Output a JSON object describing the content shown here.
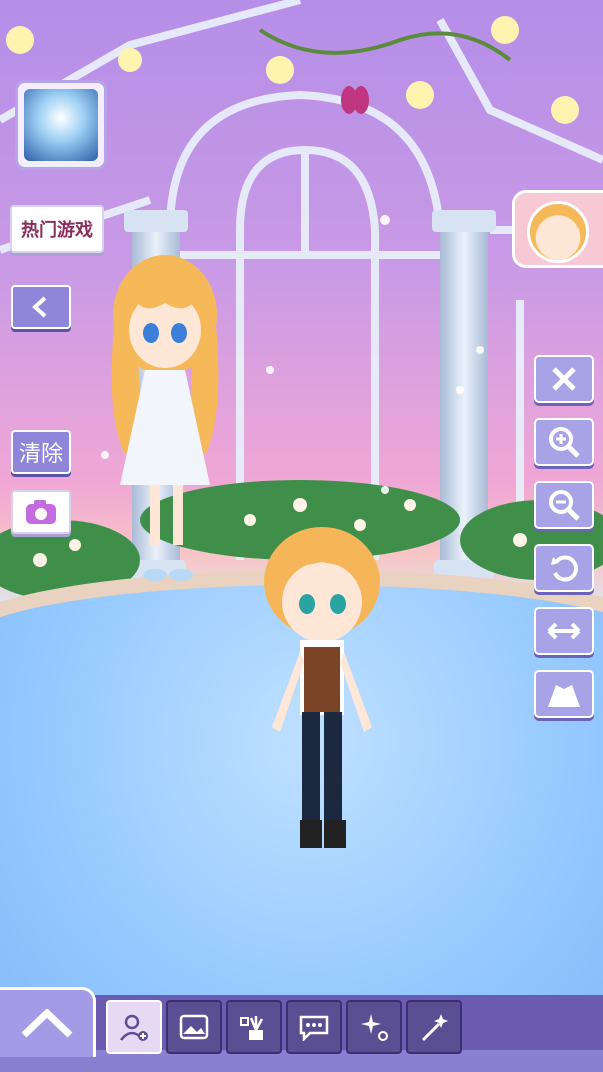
{
  "left_panel": {
    "hot_games_label": "热门游戏",
    "clear_label": "清除"
  },
  "tools": {
    "close": "close",
    "zoom_in": "zoom-in",
    "zoom_out": "zoom-out",
    "rotate": "rotate",
    "flip": "flip",
    "outfit": "outfit"
  },
  "bottom_tray": {
    "expand": "up",
    "tabs": [
      "add-character",
      "background",
      "props",
      "speech-bubble",
      "effects",
      "magic"
    ],
    "active_tab": 0
  },
  "colors": {
    "button": "#a8a2e6",
    "tray": "#5b4f93",
    "floor": "#94c8ff"
  }
}
